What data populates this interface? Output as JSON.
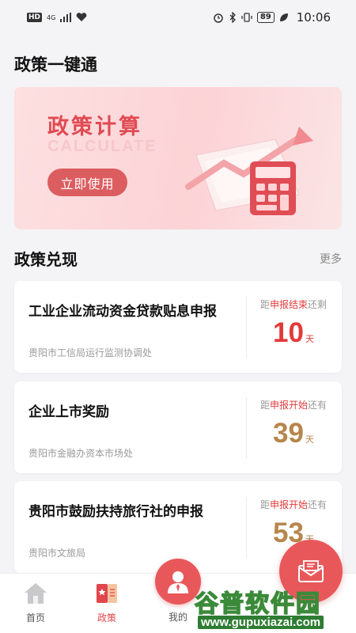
{
  "status_bar": {
    "hd": "HD",
    "network": "4G",
    "battery": "89",
    "time": "10:06"
  },
  "page_title": "政策一键通",
  "banner": {
    "title": "政策计算",
    "subtitle": "CALCULATE",
    "button": "立即使用"
  },
  "section": {
    "title": "政策兑现",
    "more": "更多"
  },
  "policies": [
    {
      "title": "工业企业流动资金贷款贴息申报",
      "dept": "贵阳市工信局运行监测协调处",
      "status_prefix": "距",
      "status_highlight": "申报结束",
      "status_suffix": "还剩",
      "days": "10",
      "unit": "天",
      "color": "#e23a3a"
    },
    {
      "title": "企业上市奖励",
      "dept": "贵阳市金融办资本市场处",
      "status_prefix": "距",
      "status_highlight": "申报开始",
      "status_suffix": "还有",
      "days": "39",
      "unit": "天",
      "color": "#b6864b"
    },
    {
      "title": "贵阳市鼓励扶持旅行社的申报",
      "dept": "贵阳市文旅局",
      "status_prefix": "距",
      "status_highlight": "申报开始",
      "status_suffix": "还有",
      "days": "53",
      "unit": "天",
      "color": "#b6864b"
    }
  ],
  "tabs": {
    "home": "首页",
    "policy": "政策",
    "mine": "我的"
  },
  "watermark": {
    "main": "谷普软件园",
    "url": "www.gupuxiazai.com"
  },
  "colors": {
    "accent": "#e8585b",
    "days_red": "#e23a3a",
    "days_gold": "#b6864b"
  }
}
